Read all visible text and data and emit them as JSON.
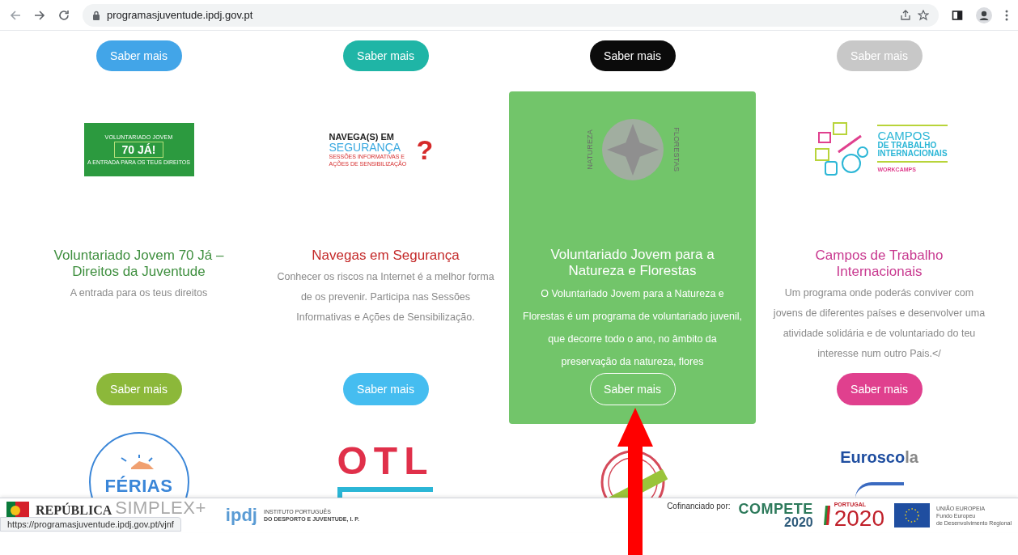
{
  "browser": {
    "url": "programasjuventude.ipdj.gov.pt"
  },
  "top_buttons": [
    {
      "label": "Saber mais",
      "color": "#42a5e8"
    },
    {
      "label": "Saber mais",
      "color": "#1fb5a6"
    },
    {
      "label": "Saber mais",
      "color": "#0b0b0b"
    },
    {
      "label": "Saber mais",
      "color": "#c8c8c8"
    }
  ],
  "programs": [
    {
      "logo": {
        "kind": "seventy",
        "texts": [
          "VOLUNTARIADO JOVEM",
          "70 JÁ!",
          "A ENTRADA PARA OS TEUS DIREITOS"
        ]
      },
      "title": {
        "text": "Voluntariado Jovem 70 Já – Direitos da Juventude",
        "color": "#3f8f3f"
      },
      "description": "A entrada para os teus direitos",
      "highlighted": false,
      "button": {
        "label": "Saber mais",
        "color": "#8cb83a"
      }
    },
    {
      "logo": {
        "kind": "navegas",
        "texts": [
          "NAVEGA(S) EM",
          "SEGURANÇA",
          "?",
          "SESSÕES INFORMATIVAS E AÇÕES DE SENSIBILIZAÇÃO"
        ]
      },
      "title": {
        "text": "Navegas em Segurança",
        "color": "#c42a2a"
      },
      "description": "Conhecer os riscos na Internet é a melhor forma de os prevenir. Participa nas Sessões Informativas e Ações de Sensibilização.",
      "highlighted": false,
      "button": {
        "label": "Saber mais",
        "color": "#45bdf0"
      }
    },
    {
      "logo": {
        "kind": "natureza",
        "texts": [
          "NATUREZA",
          "FLORESTAS"
        ]
      },
      "title": {
        "text": "Voluntariado Jovem para a Natureza e Florestas",
        "color": "#ffffff"
      },
      "description": "O Voluntariado Jovem para a Natureza e Florestas é um programa de voluntariado juvenil, que decorre todo o ano, no âmbito da preservação da natureza, flores",
      "highlighted": true,
      "button": {
        "label": "Saber mais",
        "color": "#72c56a"
      }
    },
    {
      "logo": {
        "kind": "campos",
        "texts": [
          "CAMPOS",
          "DE TRABALHO",
          "INTERNACIONAIS",
          "WORKCAMPS"
        ]
      },
      "title": {
        "text": "Campos de Trabalho Internacionais",
        "color": "#c8388f"
      },
      "description": "Um programa onde poderás conviver com jovens de diferentes países e desenvolver uma atividade solidária e de voluntariado do teu interesse num outro Pais.</",
      "highlighted": false,
      "button": {
        "label": "Saber mais",
        "color": "#e0408e"
      }
    }
  ],
  "more_programs": [
    {
      "kind": "ferias",
      "texts": [
        "FÉRIAS"
      ]
    },
    {
      "kind": "otl",
      "texts": [
        "OTL"
      ]
    },
    {
      "kind": "registo"
    },
    {
      "kind": "euroscola",
      "texts": [
        "Eurosco",
        "la"
      ]
    }
  ],
  "footer": {
    "republica": "REPÚBLICA",
    "simplex": "SIMPLEX+",
    "ipdj": [
      "ipdj",
      "INSTITUTO PORTUGUÊS",
      "DO DESPORTO E JUVENTUDE, I. P."
    ],
    "cofinanciado": "Cofinanciado por:",
    "compete": [
      "COMPETE",
      "2020"
    ],
    "portugal2020": [
      "PORTUGAL",
      "2020"
    ],
    "eu": [
      "UNIÃO EUROPEIA",
      "Fundo Europeu",
      "de Desenvolvimento Regional"
    ]
  },
  "status_link": "https://programasjuventude.ipdj.gov.pt/vjnf"
}
